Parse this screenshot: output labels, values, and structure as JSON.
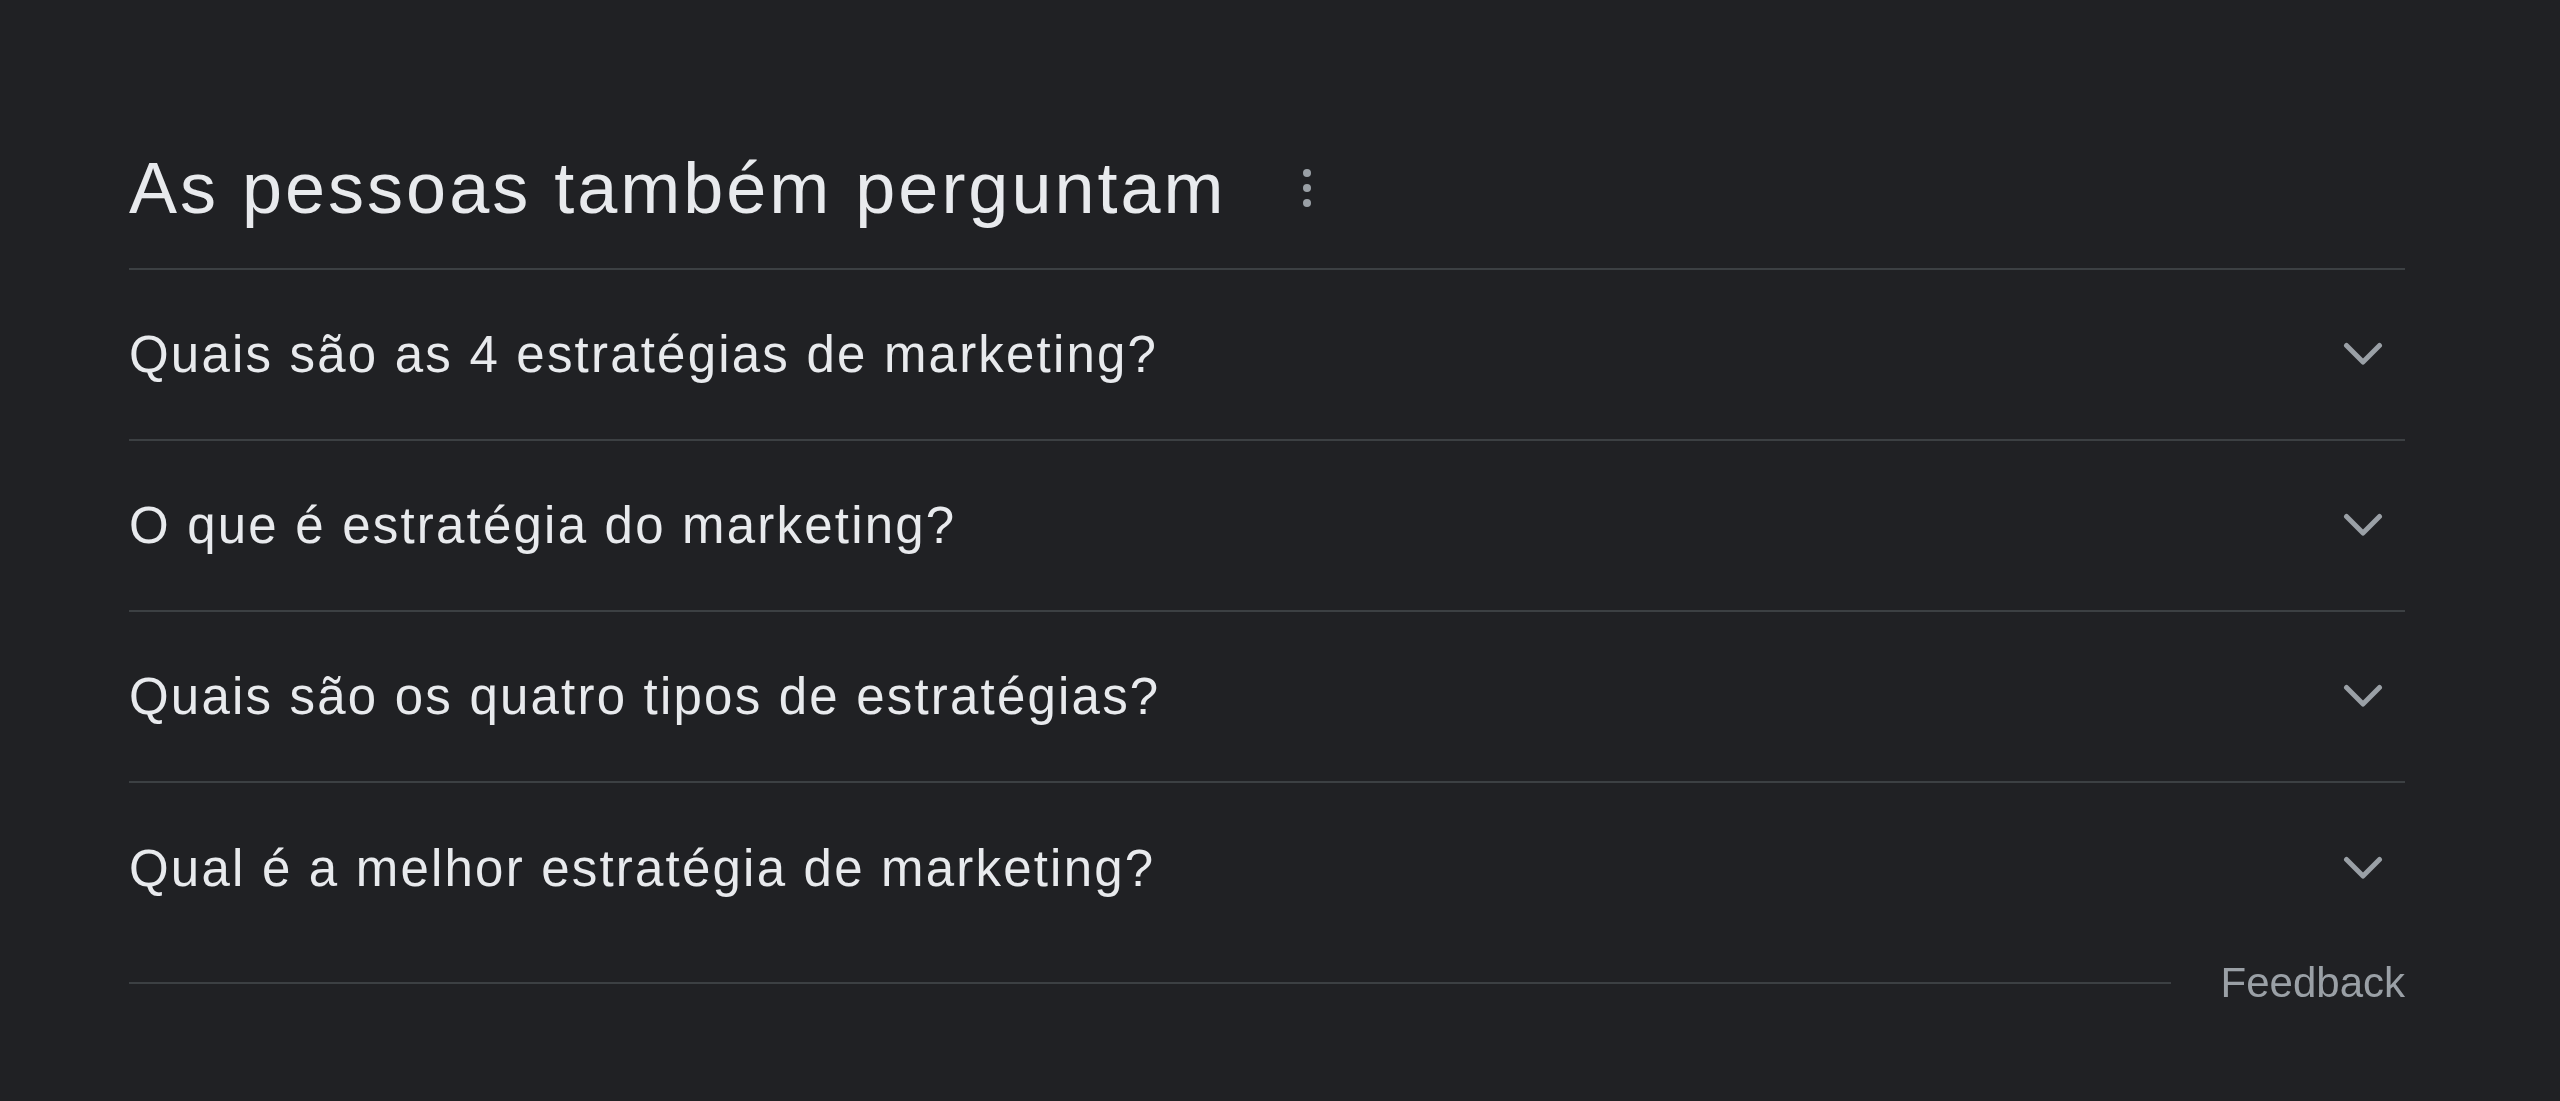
{
  "heading": "As pessoas também perguntam",
  "questions": [
    {
      "text": "Quais são as 4 estratégias de marketing?",
      "expanded": false
    },
    {
      "text": "O que é estratégia do marketing?",
      "expanded": false
    },
    {
      "text": "Quais são os quatro tipos de estratégias?",
      "expanded": false
    },
    {
      "text": "Qual é a melhor estratégia de marketing?",
      "expanded": false
    }
  ],
  "feedback": "Feedback"
}
